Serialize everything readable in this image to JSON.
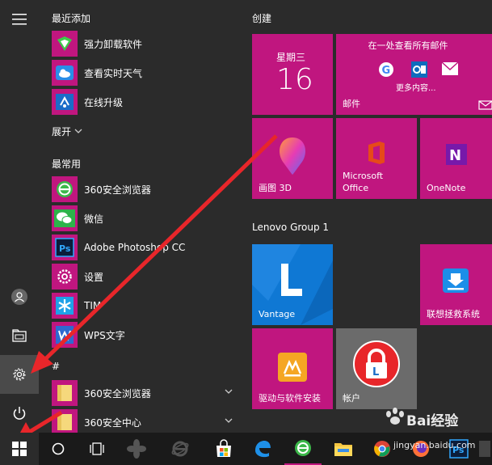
{
  "applist": {
    "recent_header": "最近添加",
    "recent": [
      {
        "label": "强力卸载软件"
      },
      {
        "label": "查看实时天气"
      },
      {
        "label": "在线升级"
      }
    ],
    "expand_label": "展开",
    "frequent_header": "最常用",
    "frequent": [
      {
        "label": "360安全浏览器"
      },
      {
        "label": "微信"
      },
      {
        "label": "Adobe Photoshop CC"
      },
      {
        "label": "设置"
      },
      {
        "label": "TIM"
      },
      {
        "label": "WPS文字"
      }
    ],
    "hash_header": "#",
    "hash": [
      {
        "label": "360安全浏览器"
      },
      {
        "label": "360安全中心"
      }
    ]
  },
  "tiles": {
    "create_header": "创建",
    "calendar": {
      "weekday": "星期三",
      "day": "16"
    },
    "mail": {
      "top": "在一处查看所有邮件",
      "more": "更多内容...",
      "label": "邮件"
    },
    "paint3d": "画图 3D",
    "office": "Microsoft Office",
    "onenote": "OneNote",
    "lenovo_header": "Lenovo Group 1",
    "vantage": "Vantage",
    "rescue": "联想拯救系统",
    "driver": "驱动与软件安装",
    "account": "帐户"
  },
  "watermark": {
    "brand": "Bai经验",
    "url": "jingyan.baidu.com"
  },
  "colors": {
    "tile": "#c0167f",
    "tile_blue": "#0f78d4",
    "tile_gray": "#6b6b6b",
    "arrow": "#e8262a"
  }
}
